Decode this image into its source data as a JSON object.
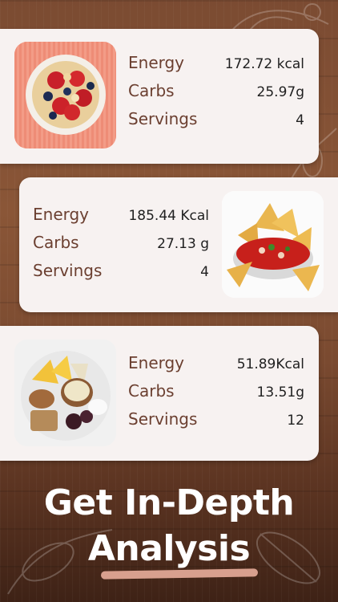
{
  "cards": [
    {
      "image_icon": "fruit-oatmeal-bowl-photo",
      "energy_label": "Energy",
      "energy_value": "172.72 kcal",
      "carbs_label": "Carbs",
      "carbs_value": "25.97g",
      "servings_label": "Servings",
      "servings_value": "4"
    },
    {
      "image_icon": "tortilla-chips-salsa-photo",
      "energy_label": "Energy",
      "energy_value": "185.44 Kcal",
      "carbs_label": "Carbs",
      "carbs_value": "27.13 g",
      "servings_label": "Servings",
      "servings_value": "4"
    },
    {
      "image_icon": "snack-platter-dip-photo",
      "energy_label": "Energy",
      "energy_value": "51.89Kcal",
      "carbs_label": "Carbs",
      "carbs_value": "13.51g",
      "servings_label": "Servings",
      "servings_value": "12"
    }
  ],
  "headline": {
    "line1": "Get In-Depth",
    "line2": "Analysis"
  },
  "colors": {
    "card_background": "#f7f2f1",
    "label_brown": "#6b3f30",
    "value_dark": "#1f1f1f",
    "wood_brown": "#7b4b32",
    "underline_accent": "#d8a08e"
  }
}
